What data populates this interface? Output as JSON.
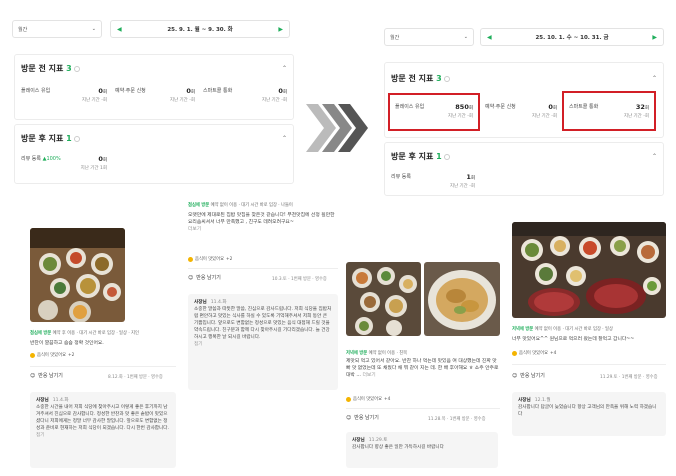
{
  "left": {
    "period": "월간",
    "range": "25. 9. 1. 월  ~  9. 30. 화",
    "pre_title": "방문 전 지표",
    "pre_count": "3",
    "metrics_pre": [
      {
        "label": "플레이스 유입",
        "value": "0",
        "unit": "회",
        "sub": "지난 기간 -회"
      },
      {
        "label": "예약·주문 신청",
        "value": "0",
        "unit": "회",
        "sub": "지난 기간 -회"
      },
      {
        "label": "스마트콜 통화",
        "value": "0",
        "unit": "회",
        "sub": "지난 기간 -회"
      }
    ],
    "post_title": "방문 후 지표",
    "post_count": "1",
    "metrics_post": [
      {
        "label": "리뷰 등록",
        "delta": "▲100%",
        "value": "0",
        "unit": "회",
        "sub": "지난 기간 1회"
      }
    ]
  },
  "right": {
    "period": "월간",
    "range": "25. 10. 1. 수  ~  10. 31. 금",
    "pre_title": "방문 전 지표",
    "pre_count": "3",
    "metrics_pre": [
      {
        "label": "플레이스 유입",
        "value": "850",
        "unit": "회",
        "sub": "지난 기간 -회"
      },
      {
        "label": "예약·주문 신청",
        "value": "0",
        "unit": "회",
        "sub": "지난 기간 -회"
      },
      {
        "label": "스마트콜 통화",
        "value": "32",
        "unit": "회",
        "sub": "지난 기간 -회"
      }
    ],
    "post_title": "방문 후 지표",
    "post_count": "1",
    "metrics_post": [
      {
        "label": "리뷰 등록",
        "value": "1",
        "unit": "회",
        "sub": "지난 기간 -회"
      }
    ]
  },
  "reviews": [
    {
      "tag_visit": "점심에 방문",
      "tag_rest": "예약 후 이용 · 대기 시간 바로 입장 · 일상 · 지인",
      "text": "반찬이 깔끔하고 슴슴 정확 것인어요.",
      "badge": "음식이 맛있어요",
      "badge_more": "+2",
      "reply": "반응 남기기",
      "meta": "8.12.화 · 1번째 방문 · 영수증",
      "owner_name": "사장님",
      "owner_date": "11.4.화",
      "owner_text": "소중한 시간을 내어 저희 식당에 찾아주시고 이렇게 좋은 후기까지 남겨주셔서 진심으로 감사합니다. 정성한 반찬과 맛 좋은 솥밥이 맛있으셨다니 저희에게는 정말 너무 감사한 말입니다. 앞으로도 변함없는 정성과 준비로 현재하는 저희 식당이 되겠습니다. 다시 한번 감사합니다.",
      "owner_more": "접기"
    },
    {
      "tag_visit": "점심에 방문",
      "tag_rest": "예약 없이 이용 · 대기 시간 바로 입장 · 나들이",
      "text": "오랫만에 제대로된 집밥 맛집을 찾은것 같습니다! 부천맛집에 선정 될만한 요리솜씨셔서 너무 만족했고 , 친구도 데려오려구요~",
      "text_more": "더보기",
      "badge": "음식이 맛있어요",
      "badge_more": "+2",
      "reply": "반응 남기기",
      "meta": "10.3.토 · 1번째 방문 · 영수증",
      "owner_name": "사장님",
      "owner_date": "11.4.화",
      "owner_text": "소중한 말씀과 따뜻한 말씀, 진심으로 감사드립니다. 저희 식당을 집밥처럼 편안하고 맛있는 식사를 하실 수 있도록 기억해주셔서 저희 동안 큰 기쁨입니다. 앞으로도 변함없는 정성으로 맛있는 음식 대접해 드릴 것을 약속드립니다. 친구분과 함께 다시 찾아주시길 기다리겠습니다. 늘 건강하시고 행복한 날 되시길 바랍니다.",
      "owner_more": "접기"
    },
    {
      "tag_visit": "저녁에 방문",
      "tag_rest": "예약 없이 이용 · 친목",
      "text": "제맛되 먹고 있어서 같아요. 반찬 하나 먹는데 맛있음 여 대상했는데 진짜 맛 빠 맛 없었는데 또 채웠다 채 뭐 같이 지는 데. 한 배 후아해요 ㅎ 소주 안주로 대박 ...",
      "text_more": "더보기",
      "badge": "음식이 맛있어요",
      "badge_more": "+4",
      "reply": "반응 남기기",
      "meta": "11.28.목 · 1번째 방문 · 영수증",
      "owner_name": "사장님",
      "owner_date": "11.29.토",
      "owner_text": "감사합니다 향상 좋은 일만 가득하시길 바랍니다",
      "owner_more": ""
    },
    {
      "tag_visit": "저녁에 방문",
      "tag_rest": "예약 없이 이용 · 대기 시간 바로 입장 · 일상",
      "text": "너무 맛있어요^^ 원님으로 먹으러 왔는데 잘먹고 갑니다~~",
      "badge": "음식이 맛있어요",
      "badge_more": "+4",
      "reply": "반응 남기기",
      "meta": "11.29.토 · 1번째 방문 · 영수증",
      "owner_name": "사장님",
      "owner_date": "12.1.월",
      "owner_text": "감사합니다 답글이 늦었습니다 항상 고객님의 만족을 위해 노력 하겠습니다",
      "owner_more": ""
    }
  ],
  "colors": {
    "accent": "#1fae5b",
    "highlight": "#d21f26",
    "muted": "#888888",
    "chevron": "#555555"
  }
}
